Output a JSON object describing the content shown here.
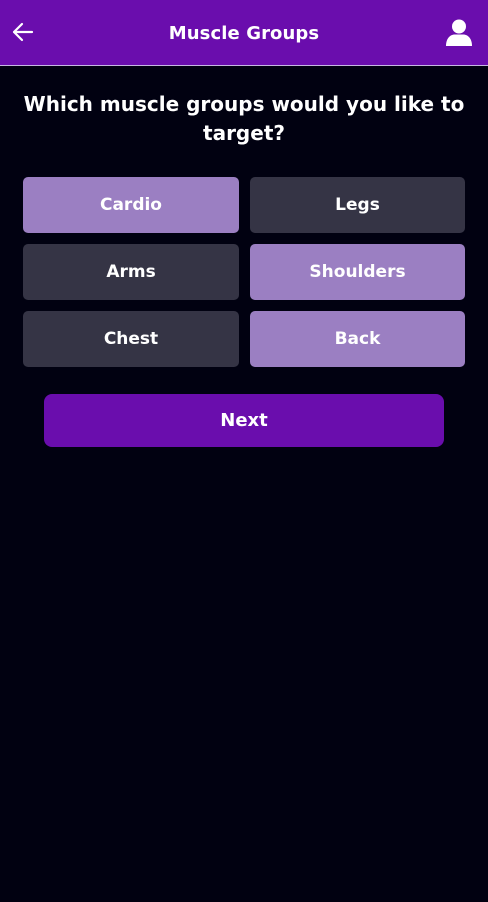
{
  "header": {
    "title": "Muscle Groups",
    "back_icon": "arrow-left-icon",
    "profile_icon": "user-icon",
    "background": "#6a0dad"
  },
  "question": "Which muscle groups would you like to target?",
  "options": [
    {
      "label": "Cardio",
      "selected": true
    },
    {
      "label": "Legs",
      "selected": false
    },
    {
      "label": "Arms",
      "selected": false
    },
    {
      "label": "Shoulders",
      "selected": true
    },
    {
      "label": "Chest",
      "selected": false
    },
    {
      "label": "Back",
      "selected": true
    }
  ],
  "next_label": "Next",
  "colors": {
    "accent": "#6a0dad",
    "selected": "#9b7fc2",
    "unselected": "#353445",
    "background": "#010111"
  }
}
